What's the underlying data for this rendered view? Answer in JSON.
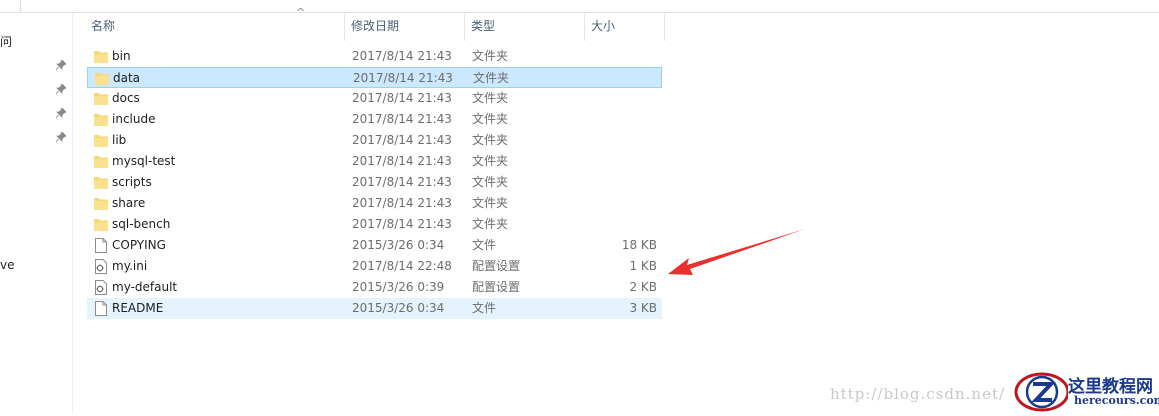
{
  "nav": {
    "fragment_top": "问",
    "fragment_bottom": "ve"
  },
  "columns": {
    "name": "名称",
    "modified": "修改日期",
    "type": "类型",
    "size": "大小"
  },
  "files": [
    {
      "name": "bin",
      "date": "2017/8/14 21:43",
      "type": "文件夹",
      "size": "",
      "icon": "folder-icon",
      "state": ""
    },
    {
      "name": "data",
      "date": "2017/8/14 21:43",
      "type": "文件夹",
      "size": "",
      "icon": "folder-icon",
      "state": "selected"
    },
    {
      "name": "docs",
      "date": "2017/8/14 21:43",
      "type": "文件夹",
      "size": "",
      "icon": "folder-icon",
      "state": ""
    },
    {
      "name": "include",
      "date": "2017/8/14 21:43",
      "type": "文件夹",
      "size": "",
      "icon": "folder-icon",
      "state": ""
    },
    {
      "name": "lib",
      "date": "2017/8/14 21:43",
      "type": "文件夹",
      "size": "",
      "icon": "folder-icon",
      "state": ""
    },
    {
      "name": "mysql-test",
      "date": "2017/8/14 21:43",
      "type": "文件夹",
      "size": "",
      "icon": "folder-icon",
      "state": ""
    },
    {
      "name": "scripts",
      "date": "2017/8/14 21:43",
      "type": "文件夹",
      "size": "",
      "icon": "folder-icon",
      "state": ""
    },
    {
      "name": "share",
      "date": "2017/8/14 21:43",
      "type": "文件夹",
      "size": "",
      "icon": "folder-icon",
      "state": ""
    },
    {
      "name": "sql-bench",
      "date": "2017/8/14 21:43",
      "type": "文件夹",
      "size": "",
      "icon": "folder-icon",
      "state": ""
    },
    {
      "name": "COPYING",
      "date": "2015/3/26 0:34",
      "type": "文件",
      "size": "18 KB",
      "icon": "file-icon",
      "state": ""
    },
    {
      "name": "my.ini",
      "date": "2017/8/14 22:48",
      "type": "配置设置",
      "size": "1 KB",
      "icon": "config-file-icon",
      "state": ""
    },
    {
      "name": "my-default",
      "date": "2015/3/26 0:39",
      "type": "配置设置",
      "size": "2 KB",
      "icon": "config-file-icon",
      "state": ""
    },
    {
      "name": "README",
      "date": "2015/3/26 0:34",
      "type": "文件",
      "size": "3 KB",
      "icon": "file-icon",
      "state": "hover"
    }
  ],
  "watermark": {
    "url": "http://blog.csdn.net/",
    "brand": "这里教程网",
    "domain": "herecours.com"
  },
  "colors": {
    "selected_bg": "#cce8ff",
    "hover_bg": "#e5f3ff",
    "folder": "#f8d775",
    "arrow": "#e8302c",
    "header_text": "#4c607a"
  }
}
